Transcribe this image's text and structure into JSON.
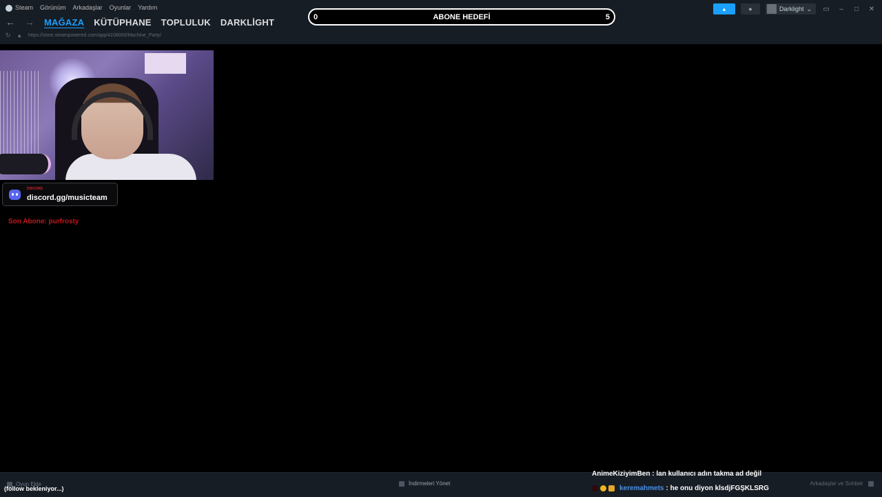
{
  "menu": {
    "steam": "Steam",
    "view": "Görünüm",
    "friends": "Arkadaşlar",
    "games": "Oyunlar",
    "help": "Yardım"
  },
  "nav": {
    "tabs": [
      "MAĞAZA",
      "KÜTÜPHANE",
      "TOPLULUK",
      "DARKLİGHT"
    ],
    "url": "https://store.steampowered.com/app/4108000/Machine_Party/"
  },
  "goal": {
    "title": "ABONE HEDEFİ",
    "start": "0",
    "end": "5"
  },
  "account": {
    "username": "Darklight"
  },
  "overlay": {
    "discord_small": "DISCORD",
    "discord_link": "discord.gg/musicteam",
    "last_sub": "Son Abone: purfrosty",
    "follow_text": "(follow bekleniyor...)"
  },
  "bottom": {
    "add_game": "Oyun Ekle",
    "downloads": "İndirmeleri Yönet",
    "friends_chat": "Arkadaşlar ve Sohbet"
  },
  "chat": [
    {
      "user": "AnimeKiziyimBen",
      "text": " : lan kullanıcı adın takma ad değil"
    },
    {
      "user": "keremahmets",
      "text": " : he onu diyon klsdjFGŞKLSRG"
    }
  ]
}
